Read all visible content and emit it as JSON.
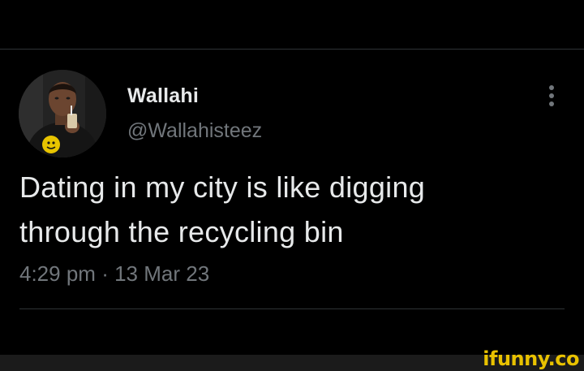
{
  "tweet": {
    "display_name": "Wallahi",
    "handle": "@Wallahisteez",
    "text_line1": "Dating in my city is like digging",
    "text_line2": "through the recycling bin",
    "time": "4:29 pm",
    "separator": "·",
    "date": "13 Mar 23"
  },
  "icons": {
    "more": "more-vertical-icon",
    "avatar": "profile-photo"
  },
  "watermark": {
    "text": "ifunny.co"
  },
  "colors": {
    "background": "#000000",
    "primary_text": "#e7e9ea",
    "secondary_text": "#71767b",
    "divider": "#2f3336",
    "watermark": "#e9c200"
  }
}
